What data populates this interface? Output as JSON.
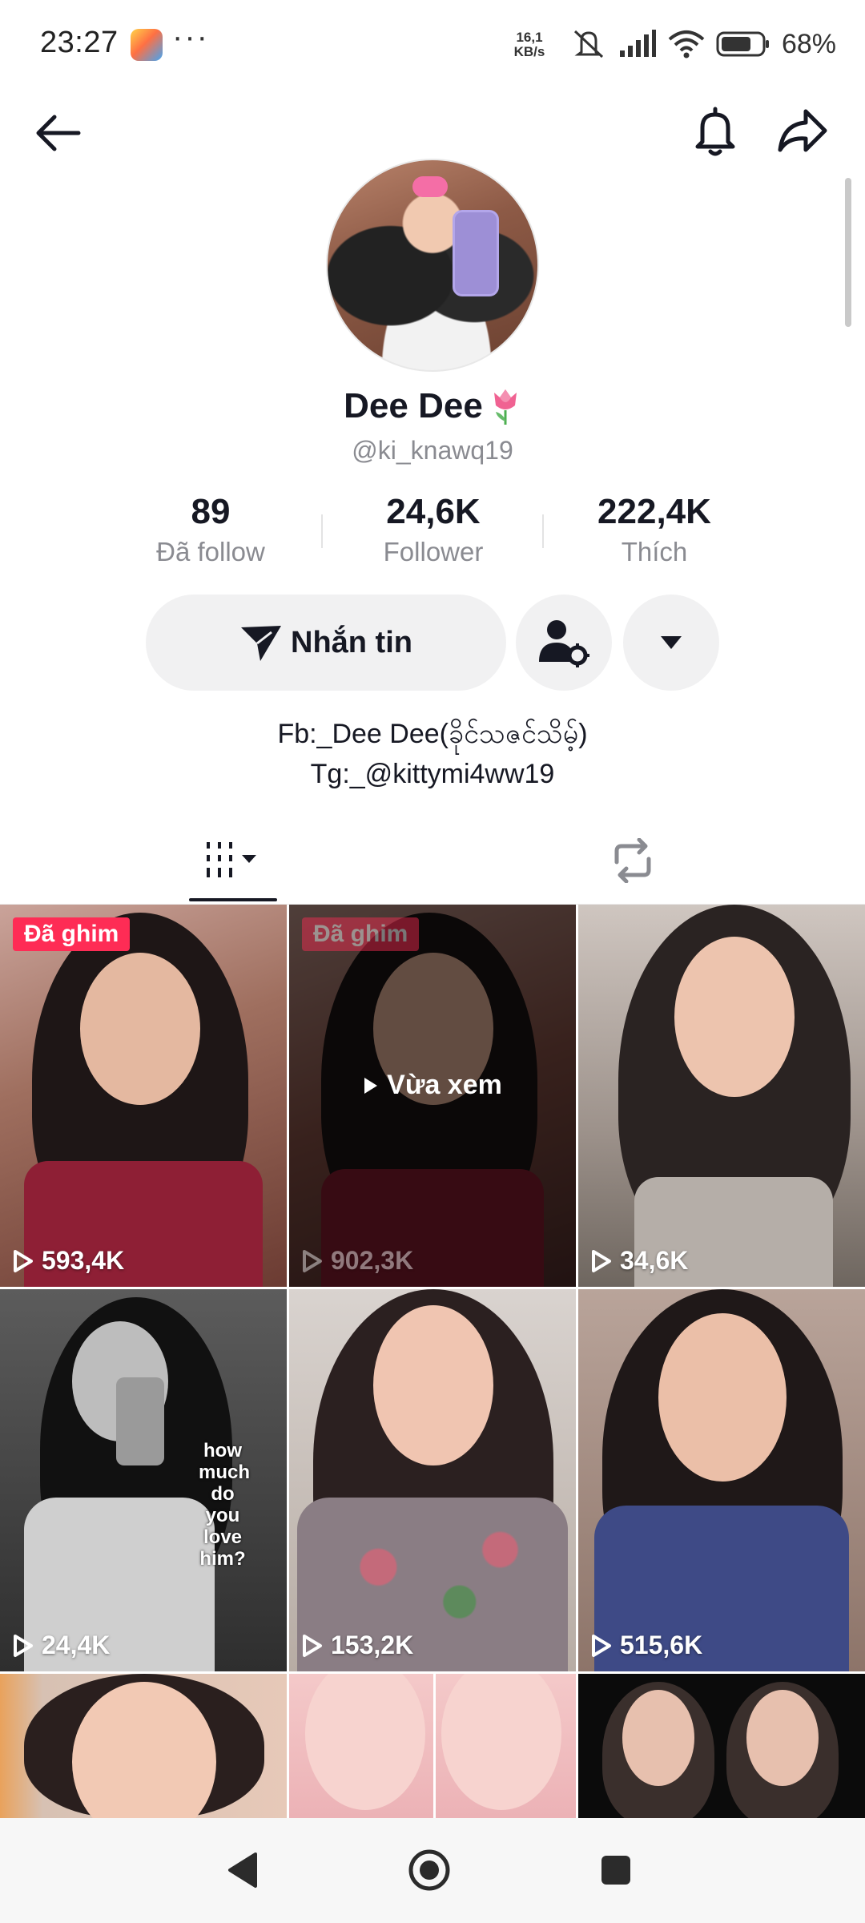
{
  "status_bar": {
    "time": "23:27",
    "more": "···",
    "net_speed_value": "16,1",
    "net_speed_unit": "KB/s",
    "battery_pct": "68%",
    "icons": [
      "app-notification-icon",
      "mute-icon",
      "signal-icon",
      "wifi-icon",
      "battery-icon"
    ]
  },
  "header": {
    "back_icon": "arrow-left-icon",
    "bell_icon": "bell-icon",
    "share_icon": "share-arrow-icon"
  },
  "profile": {
    "name": "Dee Dee",
    "name_emoji": "tulip-icon",
    "handle": "@ki_knawq19"
  },
  "stats": [
    {
      "value": "89",
      "label": "Đã follow"
    },
    {
      "value": "24,6K",
      "label": "Follower"
    },
    {
      "value": "222,4K",
      "label": "Thích"
    }
  ],
  "actions": {
    "message_label": "Nhắn tin",
    "message_icon": "send-plane-icon",
    "friends_icon": "person-settings-icon",
    "dropdown_icon": "caret-down-icon"
  },
  "bio": {
    "line1": "Fb:_Dee Dee(ခိုင်သဇင်သိမ့်)",
    "line2": "Tg:_@kittymi4ww19"
  },
  "tabs": [
    {
      "name": "videos",
      "icon": "grid-bars-icon",
      "active": true
    },
    {
      "name": "reposts",
      "icon": "repost-icon",
      "active": false
    }
  ],
  "videos": [
    {
      "views": "593,4K",
      "pinned": true,
      "pin_label": "Đã ghim"
    },
    {
      "views": "902,3K",
      "pinned": true,
      "pin_label": "Đã ghim",
      "watched_label": "Vừa xem"
    },
    {
      "views": "34,6K",
      "pinned": false
    },
    {
      "views": "24,4K",
      "pinned": false,
      "overlay_text": "how much do you love him?"
    },
    {
      "views": "153,2K",
      "pinned": false
    },
    {
      "views": "515,6K",
      "pinned": false
    },
    {
      "views": "",
      "pinned": false
    },
    {
      "views": "",
      "pinned": false
    },
    {
      "views": "",
      "pinned": false
    }
  ],
  "nav": {
    "back": "triangle-back-icon",
    "home": "circle-home-icon",
    "recents": "square-recents-icon"
  },
  "colors": {
    "accent_red": "#fe2c55",
    "text_primary": "#161823",
    "text_secondary": "#8a8b91",
    "button_bg": "#f1f1f2"
  }
}
